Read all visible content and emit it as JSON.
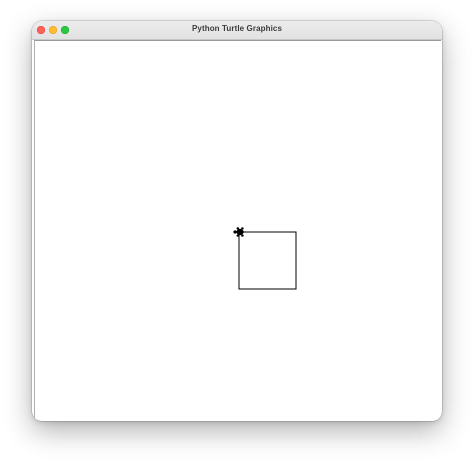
{
  "window": {
    "title": "Python Turtle Graphics"
  },
  "controls": {
    "close": "close-button",
    "minimize": "minimize-button",
    "maximize": "maximize-button"
  },
  "canvas": {
    "background": "#ffffff",
    "pen_color": "#000000",
    "turtle_shape": "turtle",
    "turtle_heading": "west"
  }
}
